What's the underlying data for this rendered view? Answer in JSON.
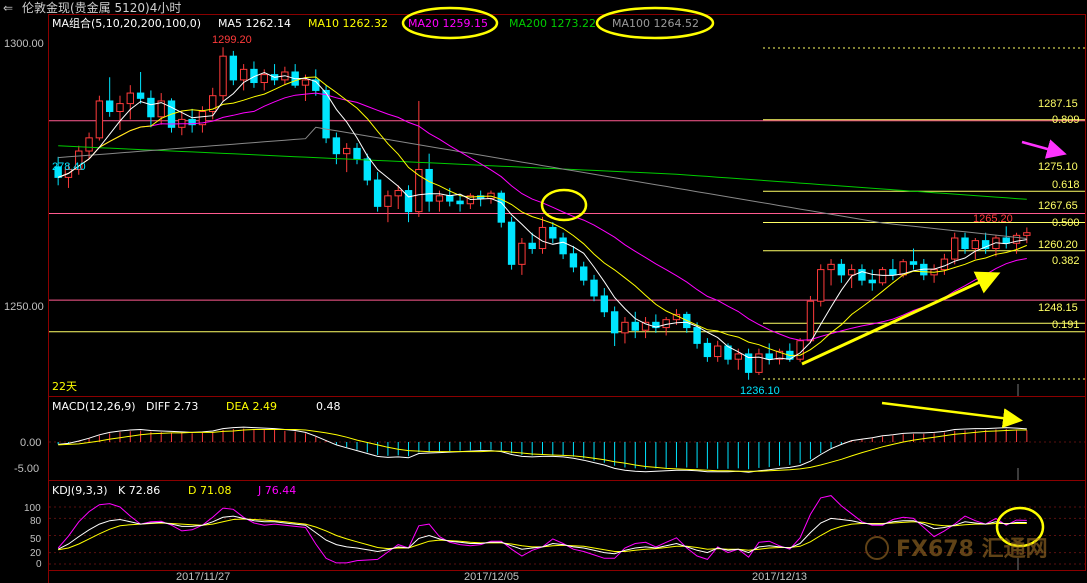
{
  "window": {
    "title": "伦敦金现(贵金属 5120)4小时",
    "back_icon": "back-arrow-icon"
  },
  "colors": {
    "bg": "#000000",
    "panel_border": "#8b0000",
    "up": "#ff3b3b",
    "down": "#00e5ff",
    "ma5": "#ffffff",
    "ma10": "#ffff00",
    "ma20": "#ff00ff",
    "ma100": "#888888",
    "ma200": "#00cc00",
    "fib": "#ffff66",
    "level": "#ff5b8f",
    "annot": "#ffff00",
    "arrow_magenta": "#ff33ff",
    "axis_text": "#c0c0c0",
    "dates": "#c0c0c0"
  },
  "main_panel": {
    "legend": [
      {
        "label": "MA组合(5,10,20,200,100,0)",
        "value": "",
        "color": "#ffffff"
      },
      {
        "label": "MA5",
        "value": "1262.14",
        "color": "#ffffff"
      },
      {
        "label": "MA10",
        "value": "1262.32",
        "color": "#ffff00"
      },
      {
        "label": "MA20",
        "value": "1259.15",
        "color": "#ff00ff",
        "circled": true
      },
      {
        "label": "MA200",
        "value": "1273.22",
        "color": "#00cc00"
      },
      {
        "label": "MA100",
        "value": "1264.52",
        "color": "#888888",
        "circled": true
      }
    ],
    "y_ticks": [
      "1300.00",
      "1250.00"
    ],
    "left_labels": {
      "value": "278.40",
      "period": "22天"
    },
    "high_label": "1299.20",
    "low_label": "1236.10",
    "last_high_label": "1265.20",
    "fib_levels": [
      {
        "price": "1287.15",
        "ratio": "0.809"
      },
      {
        "price": "1275.10",
        "ratio": "0.618"
      },
      {
        "price": "1267.65",
        "ratio": "0.500"
      },
      {
        "price": "1260.20",
        "ratio": "0.382"
      },
      {
        "price": "1248.15",
        "ratio": "0.191"
      }
    ]
  },
  "macd_panel": {
    "legend": [
      {
        "label": "MACD(12,26,9)",
        "value": "",
        "color": "#ffffff"
      },
      {
        "label": "DIFF",
        "value": "2.73",
        "color": "#ffffff"
      },
      {
        "label": "DEA",
        "value": "2.49",
        "color": "#ffff00"
      },
      {
        "label": "",
        "value": "0.48",
        "color": "#ffffff"
      }
    ],
    "y_ticks": [
      "0.00",
      "-5.00"
    ]
  },
  "kdj_panel": {
    "legend": [
      {
        "label": "KDJ(9,3,3)",
        "value": "",
        "color": "#ffffff"
      },
      {
        "label": "K",
        "value": "72.86",
        "color": "#ffffff"
      },
      {
        "label": "D",
        "value": "71.08",
        "color": "#ffff00"
      },
      {
        "label": "J",
        "value": "76.44",
        "color": "#ff00ff"
      }
    ],
    "y_ticks": [
      "100",
      "80",
      "50",
      "20",
      "0"
    ]
  },
  "x_dates": [
    "2017/11/27",
    "2017/12/05",
    "2017/12/13"
  ],
  "watermark": "FX678 汇通网",
  "chart_data": {
    "type": "candlestick",
    "title": "伦敦金现(贵金属 5120)4小时",
    "instrument": "伦敦金现",
    "timeframe": "4小时",
    "ylim": [
      1233,
      1306
    ],
    "candles": [
      [
        1276.5,
        1278.4,
        1273,
        1274.5
      ],
      [
        1274.5,
        1277,
        1272.5,
        1276
      ],
      [
        1276,
        1280.5,
        1275,
        1279.5
      ],
      [
        1279.5,
        1283,
        1278,
        1282
      ],
      [
        1282,
        1290,
        1281.5,
        1289
      ],
      [
        1289,
        1293.5,
        1286,
        1287
      ],
      [
        1287,
        1290,
        1283.5,
        1288.5
      ],
      [
        1288.5,
        1292,
        1285.5,
        1290.5
      ],
      [
        1290.5,
        1294.5,
        1288.5,
        1289.5
      ],
      [
        1289.5,
        1291,
        1284,
        1286
      ],
      [
        1286,
        1290.5,
        1284.5,
        1289
      ],
      [
        1289,
        1289.5,
        1283,
        1284
      ],
      [
        1284,
        1287,
        1282.5,
        1285.5
      ],
      [
        1285.5,
        1287.5,
        1283,
        1284.5
      ],
      [
        1284.5,
        1288,
        1283,
        1287
      ],
      [
        1287,
        1291.5,
        1285.5,
        1290
      ],
      [
        1290,
        1299.2,
        1289,
        1297.5
      ],
      [
        1297.5,
        1298.5,
        1292,
        1293
      ],
      [
        1293,
        1296,
        1291,
        1295
      ],
      [
        1295,
        1296.5,
        1291.5,
        1292.5
      ],
      [
        1292.5,
        1295,
        1291,
        1294
      ],
      [
        1294,
        1296,
        1292,
        1293
      ],
      [
        1293,
        1295.5,
        1292,
        1294.5
      ],
      [
        1294.5,
        1296,
        1291.5,
        1292
      ],
      [
        1292,
        1294,
        1289,
        1293
      ],
      [
        1293,
        1295,
        1290,
        1291
      ],
      [
        1291,
        1292,
        1281,
        1282
      ],
      [
        1282,
        1283,
        1277,
        1279
      ],
      [
        1279,
        1281,
        1275.5,
        1280
      ],
      [
        1280,
        1281,
        1277,
        1278
      ],
      [
        1278,
        1279,
        1273,
        1274
      ],
      [
        1274,
        1275.5,
        1268,
        1269
      ],
      [
        1269,
        1272,
        1266,
        1271
      ],
      [
        1271,
        1273,
        1268.5,
        1272
      ],
      [
        1272,
        1273,
        1266,
        1268
      ],
      [
        1268,
        1289,
        1267,
        1276
      ],
      [
        1276,
        1279,
        1268,
        1270
      ],
      [
        1270,
        1272,
        1268,
        1271
      ],
      [
        1271,
        1272.5,
        1269,
        1270
      ],
      [
        1270,
        1271,
        1268,
        1269.5
      ],
      [
        1269.5,
        1271.5,
        1268.5,
        1271
      ],
      [
        1271,
        1272,
        1269,
        1270.5
      ],
      [
        1270.5,
        1272,
        1269.5,
        1271.5
      ],
      [
        1271.5,
        1272,
        1265,
        1266
      ],
      [
        1266,
        1267,
        1257,
        1258
      ],
      [
        1258,
        1263,
        1256,
        1262
      ],
      [
        1262,
        1264,
        1260,
        1261
      ],
      [
        1261,
        1267,
        1260,
        1265
      ],
      [
        1265,
        1266,
        1262,
        1263
      ],
      [
        1263,
        1264,
        1259,
        1260
      ],
      [
        1260,
        1261.5,
        1256.5,
        1257.5
      ],
      [
        1257.5,
        1258.5,
        1254,
        1255
      ],
      [
        1255,
        1256,
        1251,
        1252
      ],
      [
        1252,
        1253.5,
        1248,
        1249
      ],
      [
        1249,
        1250,
        1242.5,
        1245
      ],
      [
        1245,
        1248,
        1243,
        1247
      ],
      [
        1247,
        1249,
        1244,
        1245.5
      ],
      [
        1245.5,
        1248,
        1244,
        1247
      ],
      [
        1247,
        1248.5,
        1245,
        1246
      ],
      [
        1246,
        1248,
        1244.5,
        1247.5
      ],
      [
        1247.5,
        1249.5,
        1246.5,
        1248.5
      ],
      [
        1248.5,
        1249,
        1245,
        1246
      ],
      [
        1246,
        1247,
        1242,
        1243
      ],
      [
        1243,
        1244,
        1239.5,
        1240.5
      ],
      [
        1240.5,
        1243.5,
        1239.5,
        1242.5
      ],
      [
        1242.5,
        1243,
        1239,
        1240
      ],
      [
        1240,
        1242,
        1238,
        1241
      ],
      [
        1241,
        1242,
        1236.1,
        1237.5
      ],
      [
        1237.5,
        1242,
        1237,
        1241
      ],
      [
        1241,
        1243,
        1239,
        1240
      ],
      [
        1240,
        1242,
        1239,
        1241.5
      ],
      [
        1241.5,
        1243,
        1239.5,
        1240
      ],
      [
        1240,
        1244,
        1239.5,
        1243.5
      ],
      [
        1243.5,
        1252,
        1243,
        1251
      ],
      [
        1251,
        1258,
        1250,
        1257
      ],
      [
        1257,
        1259,
        1254,
        1258
      ],
      [
        1258,
        1259,
        1254.5,
        1256
      ],
      [
        1256,
        1258,
        1253.5,
        1257
      ],
      [
        1257,
        1258,
        1254,
        1255
      ],
      [
        1255,
        1257,
        1253,
        1254.5
      ],
      [
        1254.5,
        1257.5,
        1254,
        1257
      ],
      [
        1257,
        1259,
        1255,
        1256
      ],
      [
        1256,
        1259,
        1255.5,
        1258.5
      ],
      [
        1258.5,
        1261,
        1257,
        1258
      ],
      [
        1258,
        1259,
        1255,
        1256
      ],
      [
        1256,
        1258,
        1254.5,
        1257
      ],
      [
        1257,
        1260,
        1256,
        1259
      ],
      [
        1259,
        1264,
        1258,
        1263
      ],
      [
        1263,
        1264,
        1260,
        1261
      ],
      [
        1261,
        1263,
        1259,
        1262.5
      ],
      [
        1262.5,
        1264,
        1260,
        1261
      ],
      [
        1261,
        1263.5,
        1259.5,
        1263
      ],
      [
        1263,
        1265.2,
        1261,
        1262
      ],
      [
        1262,
        1264,
        1260,
        1263.5
      ],
      [
        1263.5,
        1265,
        1262,
        1264
      ]
    ],
    "macd": {
      "diff": [
        -0.5,
        -0.3,
        0.2,
        0.8,
        1.5,
        2.0,
        2.3,
        2.5,
        2.6,
        2.4,
        2.3,
        2.2,
        2.1,
        2.0,
        2.1,
        2.3,
        2.8,
        3.0,
        3.1,
        3.0,
        2.9,
        2.8,
        2.6,
        2.4,
        2.0,
        1.2,
        0.3,
        -0.6,
        -1.2,
        -1.8,
        -2.4,
        -3.0,
        -3.2,
        -3.1,
        -3.3,
        -2.4,
        -2.3,
        -2.2,
        -2.1,
        -2.0,
        -1.9,
        -1.8,
        -1.8,
        -2.0,
        -2.6,
        -3.0,
        -3.1,
        -3.0,
        -3.0,
        -3.1,
        -3.4,
        -3.8,
        -4.3,
        -4.8,
        -5.5,
        -5.9,
        -6.1,
        -6.2,
        -6.1,
        -6.0,
        -5.9,
        -5.9,
        -6.0,
        -6.2,
        -6.2,
        -6.2,
        -6.1,
        -6.3,
        -6.0,
        -5.8,
        -5.5,
        -5.3,
        -4.9,
        -4.0,
        -2.6,
        -1.4,
        -0.5,
        0.3,
        0.6,
        0.9,
        1.3,
        1.5,
        1.8,
        1.9,
        1.9,
        2.0,
        2.2,
        2.6,
        2.7,
        2.8,
        2.8,
        2.9,
        3.0,
        2.9,
        2.73
      ],
      "dea": [
        -0.6,
        -0.5,
        -0.4,
        -0.1,
        0.2,
        0.6,
        0.9,
        1.2,
        1.5,
        1.7,
        1.8,
        1.9,
        1.9,
        2.0,
        2.0,
        2.0,
        2.2,
        2.3,
        2.5,
        2.6,
        2.6,
        2.6,
        2.6,
        2.6,
        2.5,
        2.2,
        1.9,
        1.5,
        1.0,
        0.4,
        -0.1,
        -0.6,
        -1.1,
        -1.5,
        -1.8,
        -1.9,
        -2.0,
        -2.0,
        -2.0,
        -2.0,
        -2.0,
        -2.0,
        -1.9,
        -1.9,
        -2.1,
        -2.3,
        -2.5,
        -2.6,
        -2.7,
        -2.8,
        -2.9,
        -3.1,
        -3.4,
        -3.7,
        -4.1,
        -4.4,
        -4.8,
        -5.1,
        -5.3,
        -5.5,
        -5.6,
        -5.7,
        -5.8,
        -5.9,
        -6.0,
        -6.0,
        -6.1,
        -6.1,
        -6.1,
        -6.0,
        -5.9,
        -5.8,
        -5.6,
        -5.3,
        -4.8,
        -4.2,
        -3.6,
        -2.9,
        -2.2,
        -1.6,
        -1.0,
        -0.5,
        0.0,
        0.4,
        0.7,
        1.0,
        1.3,
        1.6,
        1.8,
        2.0,
        2.2,
        2.3,
        2.4,
        2.5,
        2.49
      ]
    },
    "kdj": {
      "k": [
        26,
        35,
        48,
        60,
        70,
        76,
        78,
        74,
        70,
        72,
        73,
        70,
        66,
        66,
        68,
        74,
        82,
        84,
        80,
        76,
        74,
        74,
        72,
        70,
        68,
        55,
        42,
        34,
        30,
        28,
        25,
        22,
        25,
        30,
        28,
        45,
        50,
        44,
        40,
        38,
        36,
        36,
        38,
        38,
        32,
        26,
        28,
        30,
        36,
        34,
        30,
        28,
        24,
        20,
        18,
        24,
        28,
        30,
        28,
        32,
        36,
        30,
        24,
        20,
        28,
        24,
        26,
        20,
        30,
        32,
        30,
        28,
        36,
        55,
        72,
        80,
        78,
        76,
        72,
        70,
        70,
        74,
        76,
        76,
        70,
        62,
        64,
        68,
        74,
        72,
        70,
        74,
        70,
        73,
        72.86
      ],
      "d": [
        25,
        28,
        35,
        44,
        53,
        61,
        67,
        69,
        70,
        71,
        72,
        71,
        70,
        69,
        68,
        70,
        74,
        78,
        79,
        78,
        77,
        76,
        74,
        72,
        70,
        65,
        58,
        50,
        44,
        39,
        34,
        29,
        27,
        28,
        28,
        34,
        40,
        42,
        41,
        40,
        38,
        37,
        37,
        37,
        35,
        32,
        30,
        30,
        32,
        33,
        32,
        31,
        28,
        25,
        22,
        22,
        24,
        26,
        27,
        29,
        31,
        31,
        29,
        26,
        27,
        26,
        26,
        24,
        26,
        28,
        29,
        29,
        31,
        39,
        50,
        60,
        66,
        70,
        71,
        71,
        71,
        72,
        73,
        74,
        73,
        69,
        67,
        67,
        69,
        70,
        70,
        71,
        71,
        71,
        71.08
      ],
      "j": [
        28,
        49,
        74,
        92,
        104,
        106,
        100,
        84,
        70,
        74,
        75,
        68,
        58,
        60,
        68,
        82,
        98,
        96,
        82,
        72,
        68,
        70,
        68,
        66,
        64,
        35,
        10,
        2,
        2,
        6,
        7,
        8,
        21,
        34,
        28,
        67,
        70,
        48,
        38,
        34,
        32,
        34,
        40,
        40,
        26,
        14,
        24,
        30,
        44,
        36,
        26,
        22,
        16,
        10,
        10,
        28,
        36,
        38,
        30,
        38,
        46,
        28,
        14,
        8,
        30,
        20,
        26,
        12,
        38,
        40,
        32,
        26,
        46,
        87,
        116,
        120,
        102,
        88,
        74,
        68,
        68,
        78,
        82,
        80,
        64,
        48,
        58,
        70,
        84,
        76,
        70,
        80,
        68,
        77,
        76.44
      ]
    }
  }
}
